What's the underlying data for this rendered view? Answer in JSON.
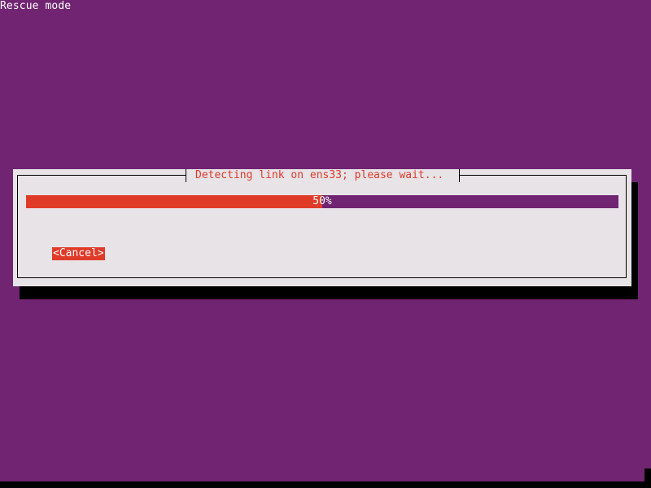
{
  "screen": {
    "title": "Rescue mode",
    "background_color": "#712471"
  },
  "dialog": {
    "title": "Detecting link on ens33; please wait...",
    "progress": {
      "percent": 50,
      "label": "50%",
      "fill_color": "#e03a29",
      "track_color": "#712471"
    },
    "cancel_button": {
      "label": "<Cancel>",
      "focused": true
    },
    "accent_color": "#e03a29",
    "background_color": "#e7e3e7"
  }
}
